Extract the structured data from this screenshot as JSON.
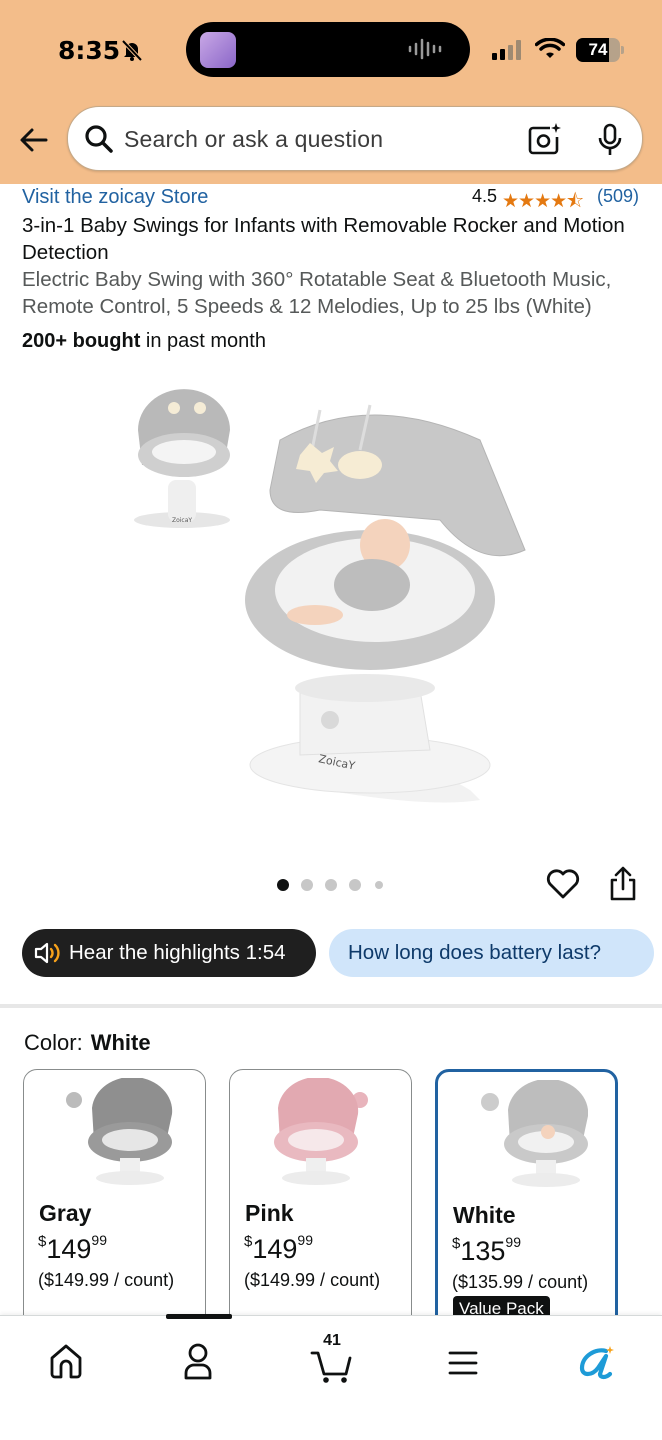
{
  "status_bar": {
    "time": "8:35",
    "battery_level": "74",
    "battery_fraction": 0.74
  },
  "search": {
    "placeholder": "Search or ask a question"
  },
  "product": {
    "store_link": "Visit the zoicay Store",
    "rating": "4.5",
    "stars": "★★★★⯪",
    "review_count": "(509)",
    "title": "3-in-1 Baby Swings for Infants with Removable Rocker and Motion Detection",
    "subtitle": "Electric Baby Swing with 360° Rotatable Seat & Bluetooth Music, Remote Control, 5 Speeds & 12 Melodies, Up to 25 lbs (White)",
    "bought_bold": "200+ bought",
    "bought_rest": " in past month",
    "brand_mark": "ZoicaY",
    "image_count": 5,
    "active_image": 1
  },
  "pills": {
    "hear_highlights": "Hear the highlights 1:54",
    "question": "How long does battery last?"
  },
  "color": {
    "label": "Color:",
    "selected": "White",
    "options": [
      {
        "name": "Gray",
        "currency": "$",
        "whole": "149",
        "fraction": "99",
        "unit_price": "($149.99 / count)",
        "badge": ""
      },
      {
        "name": "Pink",
        "currency": "$",
        "whole": "149",
        "fraction": "99",
        "unit_price": "($149.99 / count)",
        "badge": ""
      },
      {
        "name": "White",
        "currency": "$",
        "whole": "135",
        "fraction": "99",
        "unit_price": "($135.99 / count)",
        "badge": "Value Pack"
      }
    ]
  },
  "bottom_nav": {
    "items": [
      "home-icon",
      "account-icon",
      "cart-icon",
      "menu-icon",
      "rufus-icon"
    ],
    "cart_count": "41"
  },
  "colors": {
    "header_bg": "#f3bd8a",
    "link": "#2162a1",
    "star": "#e47911",
    "pill_dark": "#1f1f1f",
    "pill_light": "#d0e5fa",
    "rufus": "#1e9bd7"
  }
}
